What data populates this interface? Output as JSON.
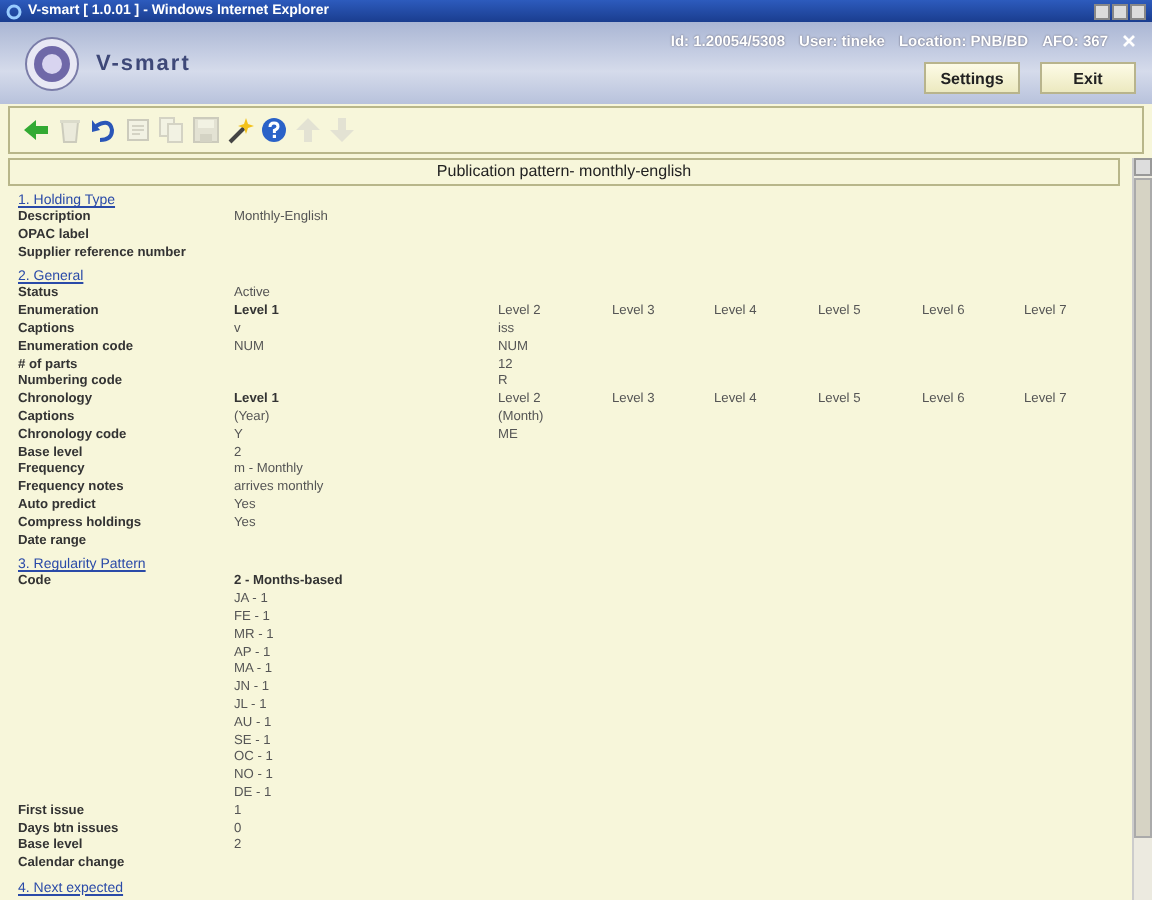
{
  "window": {
    "title": "V-smart [ 1.0.01 ] - Windows Internet Explorer"
  },
  "header": {
    "logo_text": "V-smart",
    "info": [
      "Id: 1.20054/5308",
      "User: tineke",
      "Location: PNB/BD",
      "AFO: 367"
    ],
    "buttons": [
      "Settings",
      "Exit"
    ]
  },
  "toolbar": [
    {
      "kind": "back",
      "disabled": false
    },
    {
      "kind": "delete",
      "disabled": true
    },
    {
      "kind": "undo",
      "disabled": false
    },
    {
      "kind": "copy",
      "disabled": true
    },
    {
      "kind": "paste",
      "disabled": true
    },
    {
      "kind": "save",
      "disabled": true
    },
    {
      "kind": "wand",
      "disabled": false
    },
    {
      "kind": "help",
      "disabled": false
    },
    {
      "kind": "up",
      "disabled": true
    },
    {
      "kind": "down",
      "disabled": true
    }
  ],
  "page_title": "Publication pattern- monthly-english",
  "sections": [
    {
      "title": "1. Holding Type",
      "rows": [
        {
          "label": "Description",
          "value": "Monthly-English"
        },
        {
          "label": "OPAC label"
        },
        {
          "label": "Supplier reference number"
        }
      ]
    },
    {
      "title": "2. General",
      "rows": [
        {
          "label": "Status",
          "value": "Active"
        },
        {
          "label": "Enumeration",
          "value": "Level 1",
          "emphasis": true,
          "levels": [
            "Level 2",
            "Level 3",
            "Level 4",
            "Level 5",
            "Level 6",
            "Level 7"
          ]
        },
        {
          "label": "Captions",
          "value": "v",
          "levels": [
            "iss"
          ]
        },
        {
          "label": "Enumeration code",
          "value": "NUM",
          "levels": [
            "NUM"
          ]
        },
        {
          "label": "# of parts",
          "levels": [
            "12"
          ]
        },
        {
          "label": "Numbering code",
          "levels": [
            "R"
          ]
        },
        {
          "label": "Chronology",
          "value": "Level 1",
          "emphasis": true,
          "levels": [
            "Level 2",
            "Level 3",
            "Level 4",
            "Level 5",
            "Level 6",
            "Level 7"
          ]
        },
        {
          "label": "Captions",
          "value": "(Year)",
          "levels": [
            "(Month)"
          ]
        },
        {
          "label": "Chronology code",
          "value": "Y",
          "levels": [
            "ME"
          ]
        },
        {
          "label": "Base level",
          "value": "2"
        },
        {
          "label": "Frequency",
          "value": "m - Monthly"
        },
        {
          "label": "Frequency notes",
          "value": "arrives monthly"
        },
        {
          "label": "Auto predict",
          "value": "Yes"
        },
        {
          "label": "Compress holdings",
          "value": "Yes"
        },
        {
          "label": "Date range"
        }
      ]
    },
    {
      "title": "3. Regularity Pattern",
      "rows": [
        {
          "label": "Code",
          "value": "2 - Months-based",
          "emphasis": true
        },
        {
          "value": "JA - 1"
        },
        {
          "value": "FE - 1"
        },
        {
          "value": "MR - 1"
        },
        {
          "value": "AP - 1"
        },
        {
          "value": "MA - 1"
        },
        {
          "value": "JN - 1"
        },
        {
          "value": "JL - 1"
        },
        {
          "value": "AU - 1"
        },
        {
          "value": "SE - 1"
        },
        {
          "value": "OC - 1"
        },
        {
          "value": "NO - 1"
        },
        {
          "value": "DE - 1"
        },
        {
          "label": "First issue",
          "value": "1"
        },
        {
          "label": "Days btn issues",
          "value": "0"
        },
        {
          "label": "Base level",
          "value": "2"
        },
        {
          "label": "Calendar change"
        }
      ]
    },
    {
      "title": "4. Next expected"
    }
  ]
}
